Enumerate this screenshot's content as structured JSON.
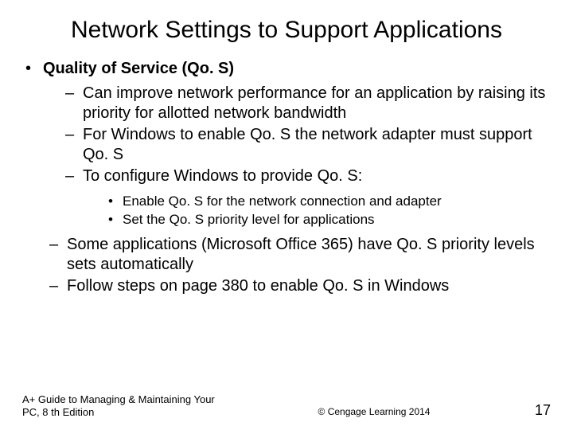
{
  "title": "Network Settings to Support Applications",
  "bullets": {
    "topic": "Quality of Service (Qo. S)",
    "sub": [
      "Can improve network performance for an application by raising its priority for allotted network bandwidth",
      "For Windows to enable Qo. S the network adapter must support Qo. S",
      "To configure Windows to provide Qo. S:"
    ],
    "subsub": [
      "Enable Qo. S for the network connection and adapter",
      "Set the Qo. S priority level for applications"
    ],
    "tail": [
      "Some applications (Microsoft Office 365) have Qo. S priority levels sets automatically",
      "Follow steps on page 380 to enable Qo. S in Windows"
    ]
  },
  "footer": {
    "left": "A+ Guide to Managing & Maintaining Your PC, 8 th Edition",
    "center": "© Cengage Learning 2014",
    "pagenum": "17"
  }
}
